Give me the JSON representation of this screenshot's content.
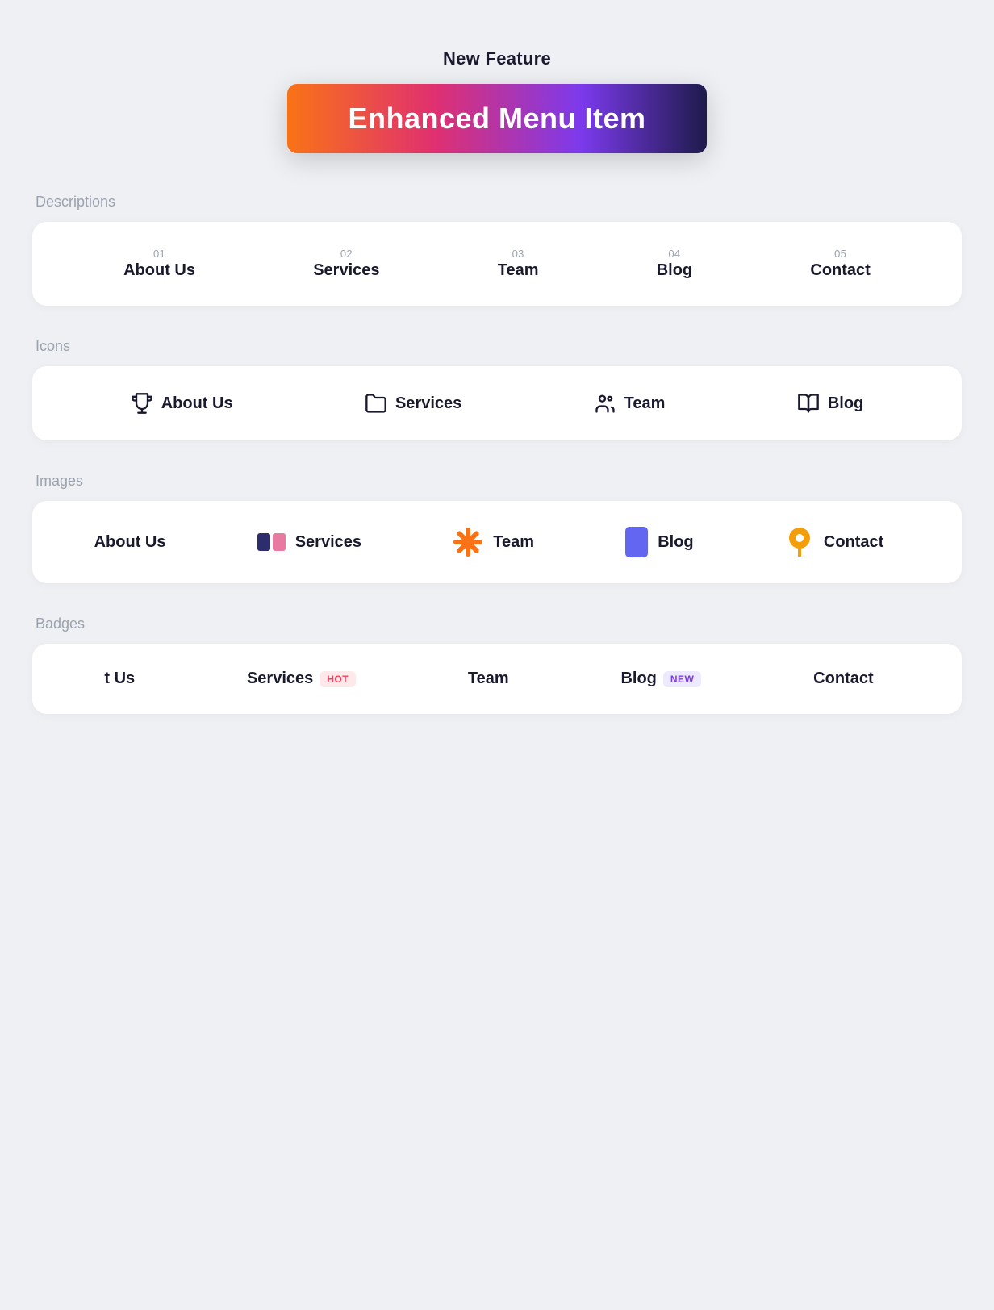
{
  "hero": {
    "new_feature_label": "New Feature",
    "button_label": "Enhanced Menu Item"
  },
  "sections": {
    "descriptions": {
      "label": "Descriptions",
      "items": [
        {
          "num": "01",
          "name": "About Us"
        },
        {
          "num": "02",
          "name": "Services"
        },
        {
          "num": "03",
          "name": "Team"
        },
        {
          "num": "04",
          "name": "Blog"
        },
        {
          "num": "05",
          "name": "Contact"
        }
      ]
    },
    "icons": {
      "label": "Icons",
      "items": [
        {
          "name": "About Us",
          "icon": "trophy"
        },
        {
          "name": "Services",
          "icon": "folder"
        },
        {
          "name": "Team",
          "icon": "people"
        },
        {
          "name": "Blog",
          "icon": "book"
        }
      ]
    },
    "images": {
      "label": "Images",
      "items": [
        {
          "name": "About Us",
          "icon_type": "none"
        },
        {
          "name": "Services",
          "icon_type": "services"
        },
        {
          "name": "Team",
          "icon_type": "team"
        },
        {
          "name": "Blog",
          "icon_type": "blog"
        },
        {
          "name": "Contact",
          "icon_type": "contact"
        }
      ]
    },
    "badges": {
      "label": "Badges",
      "items": [
        {
          "name": "About Us",
          "badge": null
        },
        {
          "name": "Services",
          "badge": "HOT"
        },
        {
          "name": "Team",
          "badge": null
        },
        {
          "name": "Blog",
          "badge": "NEW"
        },
        {
          "name": "Contact",
          "badge": null
        }
      ]
    }
  }
}
